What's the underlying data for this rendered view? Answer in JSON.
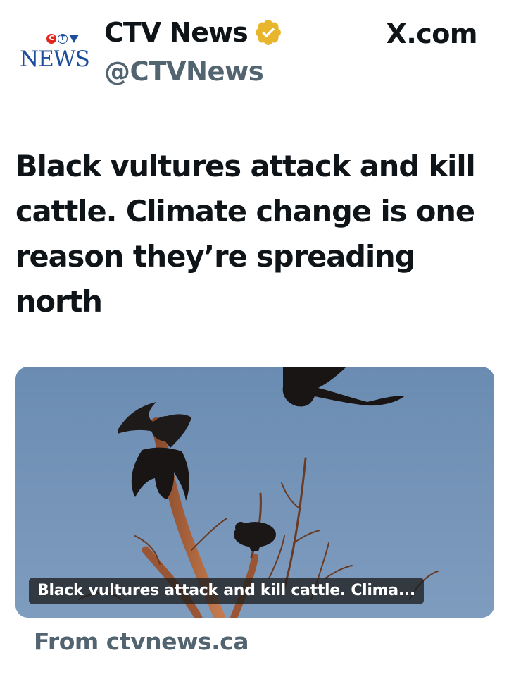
{
  "header": {
    "logo_text": "NEWS",
    "logo_badge": [
      "C",
      "T",
      "V"
    ],
    "display_name": "CTV News",
    "handle": "@CTVNews",
    "source_domain": "X.com"
  },
  "post": {
    "headline": "Black vultures attack and kill cattle. Climate change is one reason they’re spreading north"
  },
  "link_card": {
    "caption": "Black vultures attack and kill cattle. Clima...",
    "from_text": "From ctvnews.ca"
  },
  "colors": {
    "verified_badge": "#e8b62c",
    "sky": "#6f90b4",
    "handle_gray": "#536471",
    "logo_blue": "#1d4e9e"
  }
}
